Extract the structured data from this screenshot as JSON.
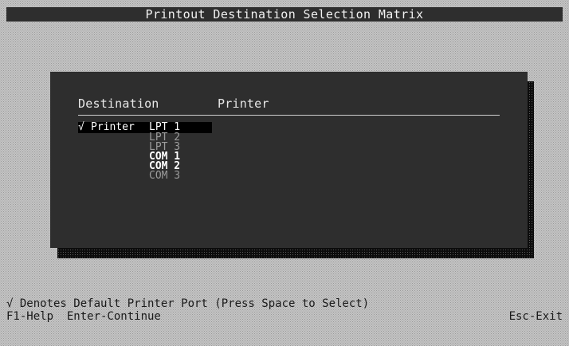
{
  "window": {
    "title": "Printout Destination Selection Matrix"
  },
  "matrix": {
    "headers": {
      "destination": "Destination",
      "printer": "Printer"
    },
    "destinations": [
      {
        "check": "√",
        "kind": "Printer",
        "port": "LPT 1",
        "state": "selected"
      },
      {
        "check": "",
        "kind": "",
        "port": "LPT 2",
        "state": "dim"
      },
      {
        "check": "",
        "kind": "",
        "port": "LPT 3",
        "state": "dim"
      },
      {
        "check": "",
        "kind": "",
        "port": "COM 1",
        "state": "bright"
      },
      {
        "check": "",
        "kind": "",
        "port": "COM 2",
        "state": "bright"
      },
      {
        "check": "",
        "kind": "",
        "port": "COM 3",
        "state": "dim"
      }
    ]
  },
  "status_bar": {
    "legend": "√ Denotes Default Printer Port (Press Space to Select)",
    "help_keys": "F1-Help  Enter-Continue",
    "exit_key": "Esc-Exit"
  },
  "colors": {
    "panel": "#2e2e2e",
    "desktop": "#c4c4c4",
    "highlight_bg": "#000000",
    "highlight_fg": "#ffffff",
    "dim_text": "#9c9c9c"
  }
}
